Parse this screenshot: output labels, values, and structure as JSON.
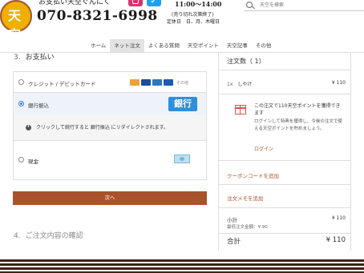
{
  "header": {
    "logo_char": "天空",
    "top_text": "お支払い天空ぐんにく",
    "phone": "070-8321-6998",
    "hours": "11:00〜14:00",
    "hours_note": "(売り切れ次第終了)",
    "closed_days": "定休日　日、月、木曜日",
    "search_placeholder": "天空を検索"
  },
  "nav": {
    "items": [
      "ホーム",
      "ネット注文",
      "よくある質問",
      "天空ポイント",
      "天空記事",
      "その他"
    ],
    "active_index": 1
  },
  "checkout": {
    "section3_num": "3.",
    "section3_title": "お支払い",
    "options": {
      "credit": {
        "label": "クレジット / デビットカード",
        "more": "その他"
      },
      "bank": {
        "label": "銀行振込",
        "badge": "銀行",
        "selected": true
      },
      "bank_info": "クリックして続行すると 銀行振込 にリダイレクトされます。",
      "cash": {
        "label": "現金"
      }
    },
    "next_button": "次へ",
    "section4_num": "4.",
    "section4_title": "ご注文内容の確認"
  },
  "summary": {
    "title": "注文数（ 1）",
    "item": {
      "qty": "1x",
      "name": "しやけ",
      "price": "¥ 110"
    },
    "points_text": "この注文で110天空ポイントを獲得できます",
    "points_sub": "ログインして特典を獲得し、今後の注文で使える天空ポイントを貯めましょう。",
    "login_link": "ログイン",
    "coupon_link": "クーポンコードを追加",
    "memo_link": "注文メモを追加",
    "subtotal_label": "小計",
    "subtotal_value": "¥ 110",
    "min_label": "最低注文金額：¥ 90",
    "total_label": "合計",
    "total_value": "¥ 110"
  },
  "colors": {
    "accent": "#a8532b",
    "bank_badge": "#2f8fd8",
    "selected_bg": "#eef3fb",
    "footer_stripe": "#3a2416"
  }
}
